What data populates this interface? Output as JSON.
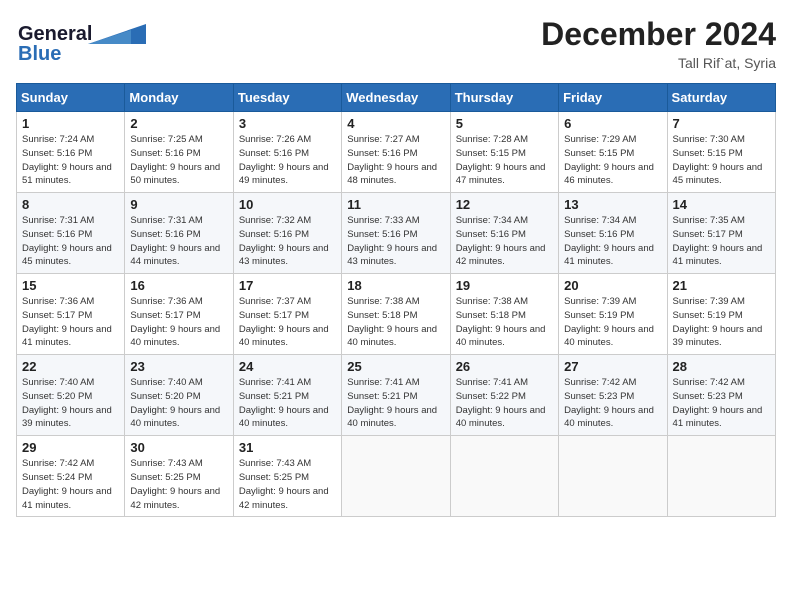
{
  "header": {
    "logo_line1": "General",
    "logo_line2": "Blue",
    "month": "December 2024",
    "location": "Tall Rif`at, Syria"
  },
  "weekdays": [
    "Sunday",
    "Monday",
    "Tuesday",
    "Wednesday",
    "Thursday",
    "Friday",
    "Saturday"
  ],
  "weeks": [
    [
      {
        "day": 1,
        "sunrise": "7:24 AM",
        "sunset": "5:16 PM",
        "daylight": "9 hours and 51 minutes."
      },
      {
        "day": 2,
        "sunrise": "7:25 AM",
        "sunset": "5:16 PM",
        "daylight": "9 hours and 50 minutes."
      },
      {
        "day": 3,
        "sunrise": "7:26 AM",
        "sunset": "5:16 PM",
        "daylight": "9 hours and 49 minutes."
      },
      {
        "day": 4,
        "sunrise": "7:27 AM",
        "sunset": "5:16 PM",
        "daylight": "9 hours and 48 minutes."
      },
      {
        "day": 5,
        "sunrise": "7:28 AM",
        "sunset": "5:15 PM",
        "daylight": "9 hours and 47 minutes."
      },
      {
        "day": 6,
        "sunrise": "7:29 AM",
        "sunset": "5:15 PM",
        "daylight": "9 hours and 46 minutes."
      },
      {
        "day": 7,
        "sunrise": "7:30 AM",
        "sunset": "5:15 PM",
        "daylight": "9 hours and 45 minutes."
      }
    ],
    [
      {
        "day": 8,
        "sunrise": "7:31 AM",
        "sunset": "5:16 PM",
        "daylight": "9 hours and 45 minutes."
      },
      {
        "day": 9,
        "sunrise": "7:31 AM",
        "sunset": "5:16 PM",
        "daylight": "9 hours and 44 minutes."
      },
      {
        "day": 10,
        "sunrise": "7:32 AM",
        "sunset": "5:16 PM",
        "daylight": "9 hours and 43 minutes."
      },
      {
        "day": 11,
        "sunrise": "7:33 AM",
        "sunset": "5:16 PM",
        "daylight": "9 hours and 43 minutes."
      },
      {
        "day": 12,
        "sunrise": "7:34 AM",
        "sunset": "5:16 PM",
        "daylight": "9 hours and 42 minutes."
      },
      {
        "day": 13,
        "sunrise": "7:34 AM",
        "sunset": "5:16 PM",
        "daylight": "9 hours and 41 minutes."
      },
      {
        "day": 14,
        "sunrise": "7:35 AM",
        "sunset": "5:17 PM",
        "daylight": "9 hours and 41 minutes."
      }
    ],
    [
      {
        "day": 15,
        "sunrise": "7:36 AM",
        "sunset": "5:17 PM",
        "daylight": "9 hours and 41 minutes."
      },
      {
        "day": 16,
        "sunrise": "7:36 AM",
        "sunset": "5:17 PM",
        "daylight": "9 hours and 40 minutes."
      },
      {
        "day": 17,
        "sunrise": "7:37 AM",
        "sunset": "5:17 PM",
        "daylight": "9 hours and 40 minutes."
      },
      {
        "day": 18,
        "sunrise": "7:38 AM",
        "sunset": "5:18 PM",
        "daylight": "9 hours and 40 minutes."
      },
      {
        "day": 19,
        "sunrise": "7:38 AM",
        "sunset": "5:18 PM",
        "daylight": "9 hours and 40 minutes."
      },
      {
        "day": 20,
        "sunrise": "7:39 AM",
        "sunset": "5:19 PM",
        "daylight": "9 hours and 40 minutes."
      },
      {
        "day": 21,
        "sunrise": "7:39 AM",
        "sunset": "5:19 PM",
        "daylight": "9 hours and 39 minutes."
      }
    ],
    [
      {
        "day": 22,
        "sunrise": "7:40 AM",
        "sunset": "5:20 PM",
        "daylight": "9 hours and 39 minutes."
      },
      {
        "day": 23,
        "sunrise": "7:40 AM",
        "sunset": "5:20 PM",
        "daylight": "9 hours and 40 minutes."
      },
      {
        "day": 24,
        "sunrise": "7:41 AM",
        "sunset": "5:21 PM",
        "daylight": "9 hours and 40 minutes."
      },
      {
        "day": 25,
        "sunrise": "7:41 AM",
        "sunset": "5:21 PM",
        "daylight": "9 hours and 40 minutes."
      },
      {
        "day": 26,
        "sunrise": "7:41 AM",
        "sunset": "5:22 PM",
        "daylight": "9 hours and 40 minutes."
      },
      {
        "day": 27,
        "sunrise": "7:42 AM",
        "sunset": "5:23 PM",
        "daylight": "9 hours and 40 minutes."
      },
      {
        "day": 28,
        "sunrise": "7:42 AM",
        "sunset": "5:23 PM",
        "daylight": "9 hours and 41 minutes."
      }
    ],
    [
      {
        "day": 29,
        "sunrise": "7:42 AM",
        "sunset": "5:24 PM",
        "daylight": "9 hours and 41 minutes."
      },
      {
        "day": 30,
        "sunrise": "7:43 AM",
        "sunset": "5:25 PM",
        "daylight": "9 hours and 42 minutes."
      },
      {
        "day": 31,
        "sunrise": "7:43 AM",
        "sunset": "5:25 PM",
        "daylight": "9 hours and 42 minutes."
      },
      null,
      null,
      null,
      null
    ]
  ]
}
